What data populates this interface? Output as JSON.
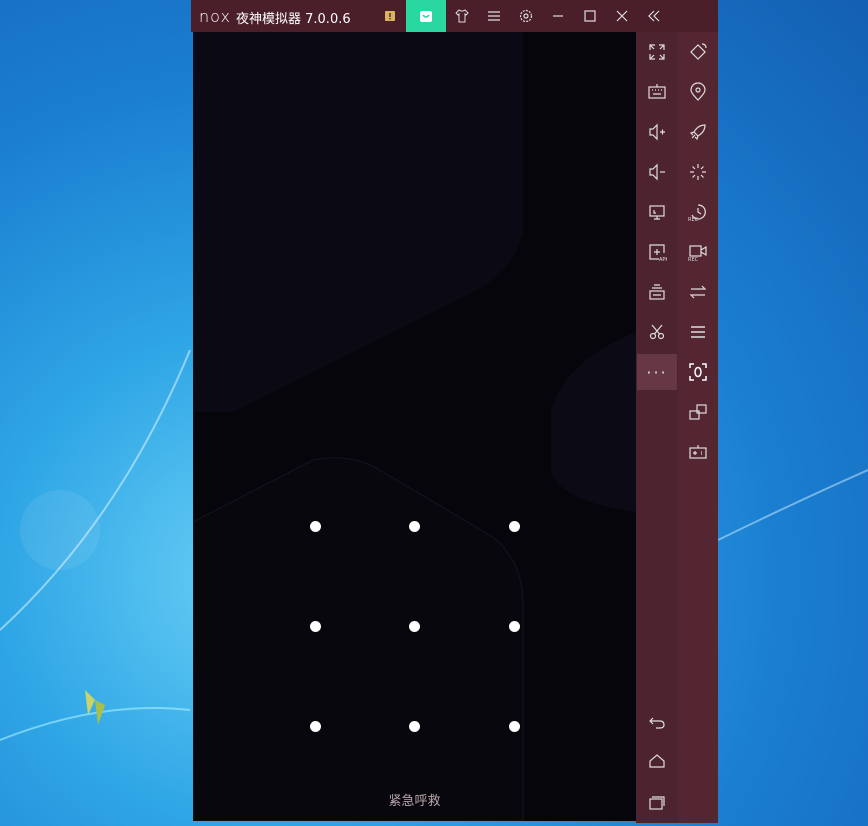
{
  "window": {
    "logo": "nox",
    "title": "夜神模拟器 7.0.0.6"
  },
  "titlebar_buttons": [
    "notice-icon",
    "app-store-icon",
    "skin-icon",
    "menu-icon",
    "settings-icon",
    "minimize-icon",
    "maximize-icon",
    "close-icon",
    "collapse-icon"
  ],
  "screen": {
    "emergency_call": "紧急呼救",
    "pattern_dots": 9
  },
  "sidebar_primary": [
    "fullscreen-icon",
    "keyboard-icon",
    "volume-up-icon",
    "volume-down-icon",
    "screenshot-icon",
    "install-apk-icon",
    "multi-instance-icon",
    "scissors-icon",
    "more-icon",
    "back-icon",
    "home-icon",
    "recent-apps-icon"
  ],
  "sidebar_secondary": [
    "rotate-icon",
    "location-icon",
    "rocket-icon",
    "loading-icon",
    "macro-record-icon",
    "video-record-icon",
    "sync-icon",
    "list-icon",
    "zero-icon",
    "multi-window-icon",
    "gamepad-icon"
  ],
  "colors": {
    "titlebar": "#4a1f2a",
    "store_button": "#2ad7a0",
    "sidebar": "#542631",
    "screen": "#06050b"
  }
}
